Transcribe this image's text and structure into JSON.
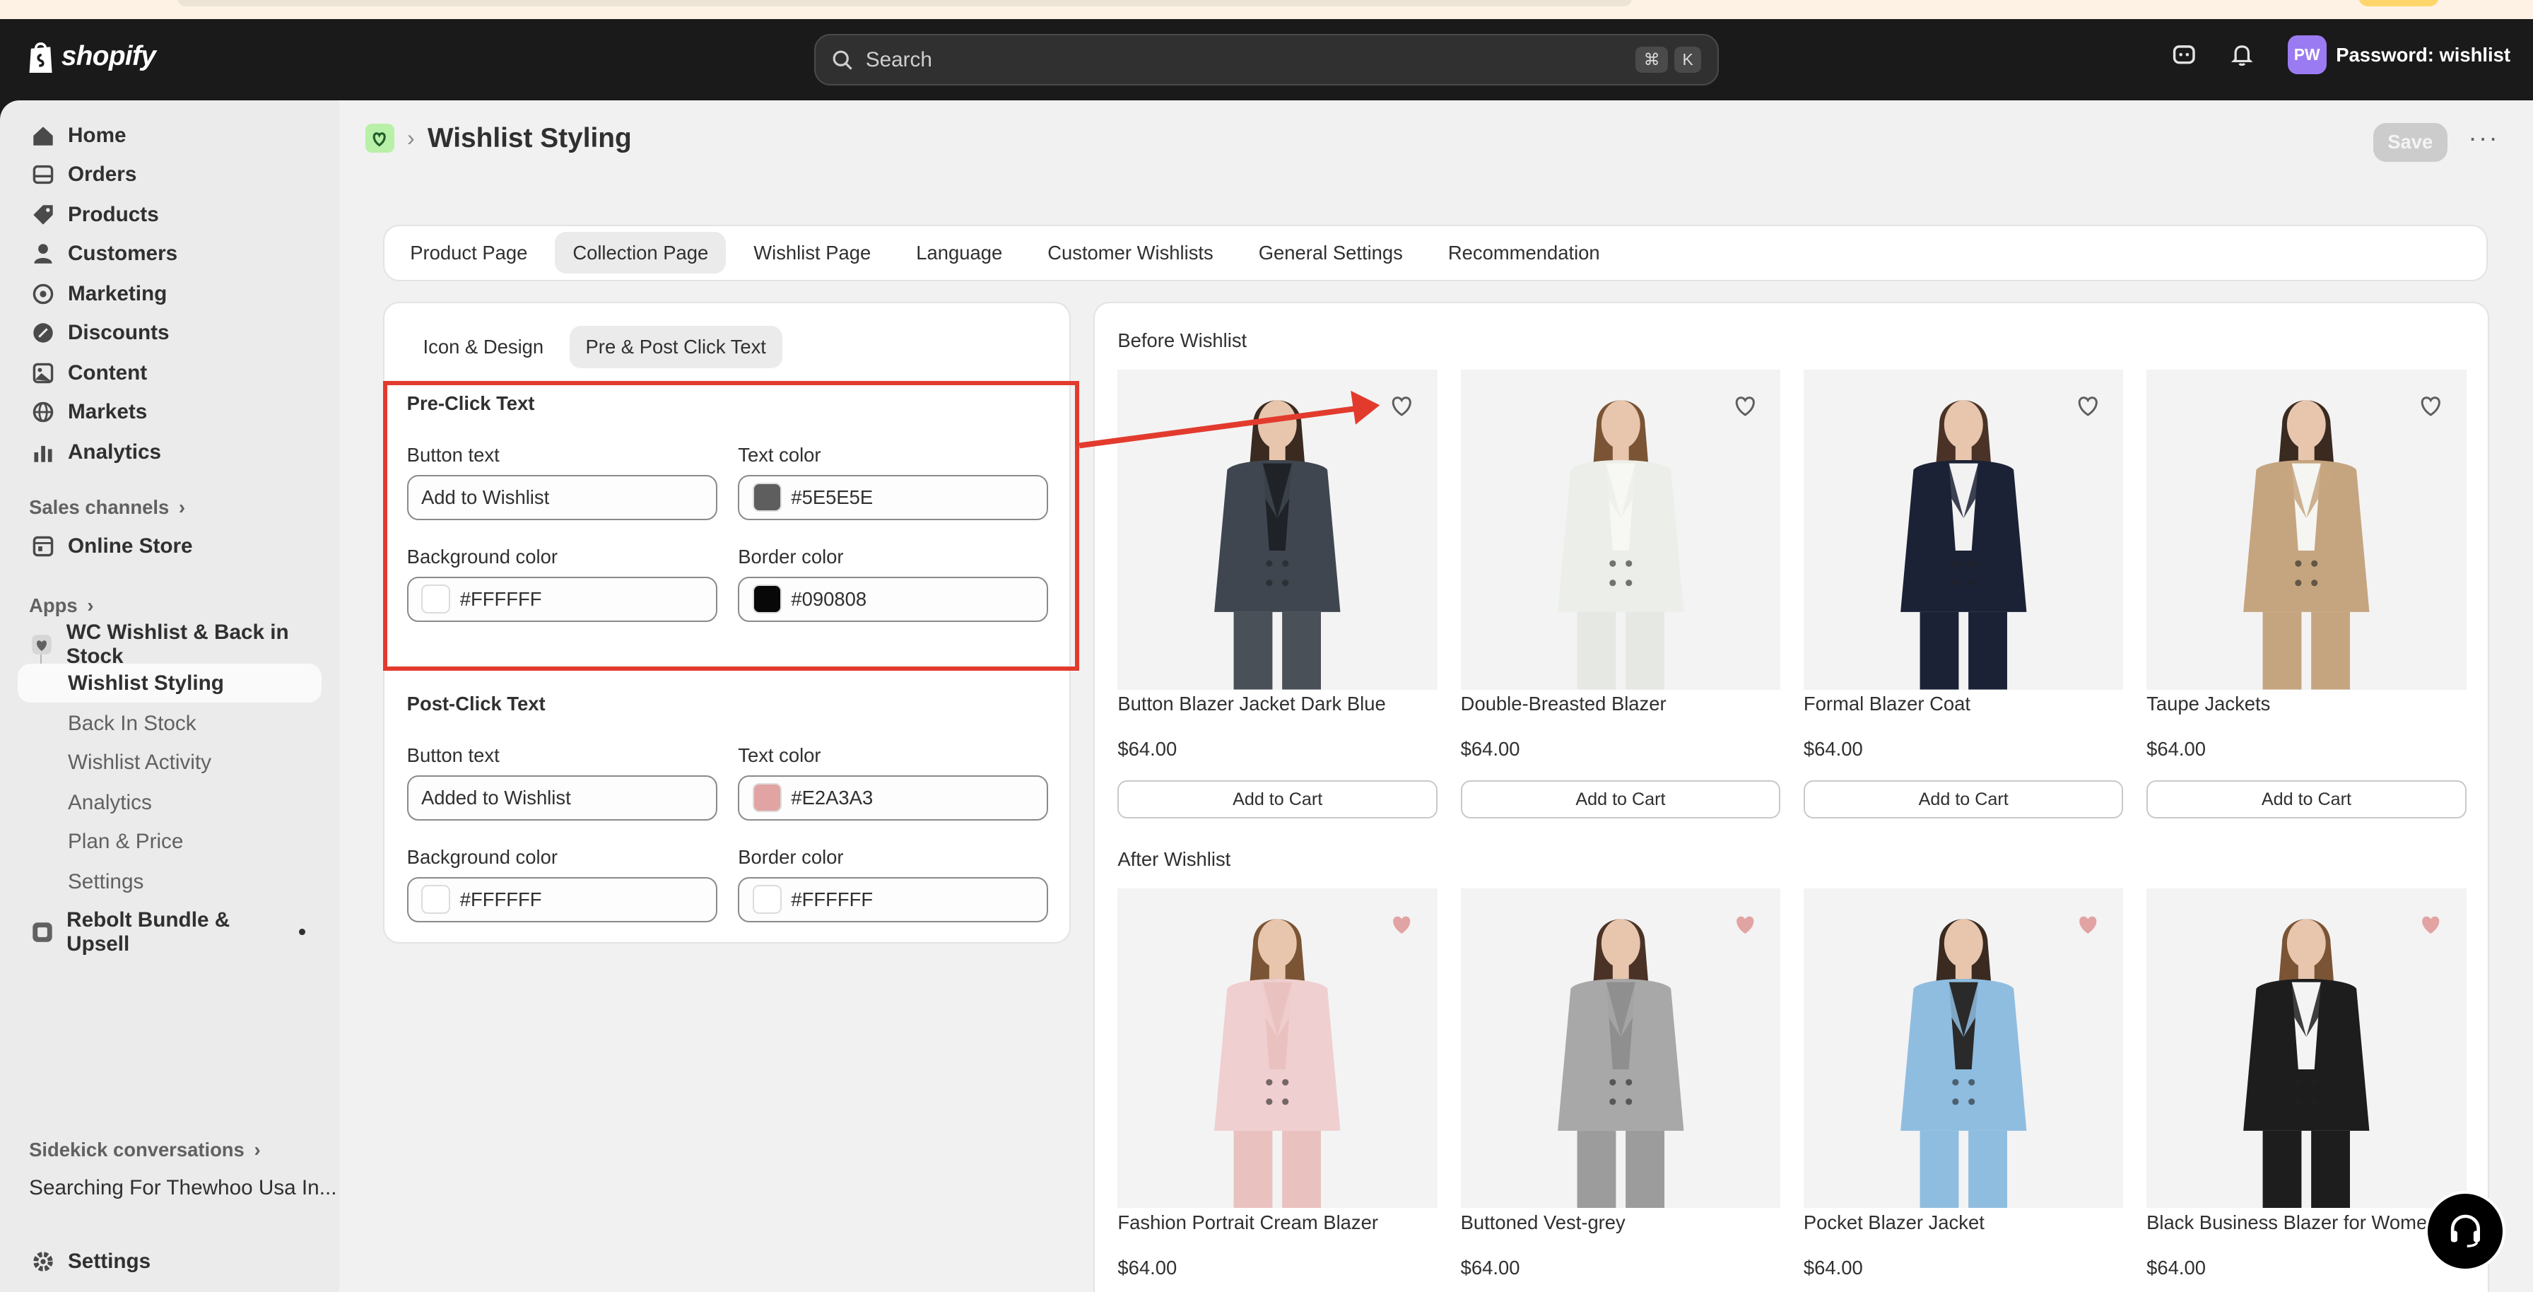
{
  "topbar": {
    "brand": "shopify",
    "search_placeholder": "Search",
    "shortcut": [
      "⌘",
      "K"
    ],
    "avatar_initials": "PW",
    "store_name": "Password: wishlist"
  },
  "sidebar": {
    "main_items": [
      {
        "label": "Home",
        "icon": "home-icon"
      },
      {
        "label": "Orders",
        "icon": "orders-icon"
      },
      {
        "label": "Products",
        "icon": "tag-icon"
      },
      {
        "label": "Customers",
        "icon": "person-icon"
      },
      {
        "label": "Marketing",
        "icon": "target-icon"
      },
      {
        "label": "Discounts",
        "icon": "discount-icon"
      },
      {
        "label": "Content",
        "icon": "content-icon"
      },
      {
        "label": "Markets",
        "icon": "globe-icon"
      },
      {
        "label": "Analytics",
        "icon": "bar-chart-icon"
      }
    ],
    "sales_channels_label": "Sales channels",
    "online_store": "Online Store",
    "apps_label": "Apps",
    "app_name": "WC Wishlist & Back in Stock",
    "app_subitems": [
      "Wishlist Styling",
      "Back In Stock",
      "Wishlist Activity",
      "Analytics",
      "Plan & Price",
      "Settings"
    ],
    "other_app": "Rebolt Bundle & Upsell",
    "sidekick_label": "Sidekick conversations",
    "sidekick_item": "Searching For Thewhoo Usa In...",
    "settings": "Settings"
  },
  "page": {
    "title": "Wishlist Styling",
    "save": "Save",
    "more": "···"
  },
  "tabs": [
    "Product Page",
    "Collection Page",
    "Wishlist Page",
    "Language",
    "Customer Wishlists",
    "General Settings",
    "Recommendation"
  ],
  "active_tab": "Collection Page",
  "subtabs": [
    "Icon & Design",
    "Pre & Post Click Text"
  ],
  "pre_click": {
    "title": "Pre-Click Text",
    "button_text_label": "Button text",
    "button_text": "Add to Wishlist",
    "text_color_label": "Text color",
    "text_color": "#5E5E5E",
    "bg_color_label": "Background color",
    "bg_color": "#FFFFFF",
    "border_color_label": "Border color",
    "border_color": "#090808"
  },
  "post_click": {
    "title": "Post-Click Text",
    "button_text_label": "Button text",
    "button_text": "Added to Wishlist",
    "text_color_label": "Text color",
    "text_color": "#E2A3A3",
    "bg_color_label": "Background color",
    "bg_color": "#FFFFFF",
    "border_color_label": "Border color",
    "border_color": "#FFFFFF"
  },
  "preview": {
    "before_label": "Before Wishlist",
    "after_label": "After Wishlist",
    "add_to_cart": "Add to Cart",
    "before_products": [
      {
        "name": "Button Blazer Jacket Dark Blue",
        "price": "$64.00",
        "jacket": "#3f4650",
        "inner": "#1f2328",
        "pants": "#4a5058"
      },
      {
        "name": "Double-Breasted Blazer",
        "price": "$64.00",
        "jacket": "#eceee9",
        "inner": "#f7f7f4",
        "pants": "#e6e8e3"
      },
      {
        "name": "Formal Blazer Coat",
        "price": "$64.00",
        "jacket": "#1b2236",
        "inner": "#f2f2f2",
        "pants": "#1b2236"
      },
      {
        "name": "Taupe Jackets",
        "price": "$64.00",
        "jacket": "#c5a57f",
        "inner": "#f5f5f2",
        "pants": "#c5a57f"
      }
    ],
    "after_products": [
      {
        "name": "Fashion Portrait Cream Blazer",
        "price": "$64.00",
        "jacket": "#f0cfd0",
        "inner": "#e9c2c0",
        "pants": "#e9c2c0"
      },
      {
        "name": "Buttoned Vest-grey",
        "price": "$64.00",
        "jacket": "#a8a8a8",
        "inner": "#8f8f8f",
        "pants": "#9c9c9c"
      },
      {
        "name": "Pocket Blazer Jacket",
        "price": "$64.00",
        "jacket": "#8fbde0",
        "inner": "#2a2a2a",
        "pants": "#8fbde0"
      },
      {
        "name": "Black Business Blazer for Women",
        "price": "$64.00",
        "jacket": "#1d1d1d",
        "inner": "#f4f4f4",
        "pants": "#1d1d1d"
      }
    ]
  },
  "colors": {
    "accent_red": "#e23b2e",
    "heart_outline": "#5e5e5e",
    "heart_filled": "#e2a3a3"
  }
}
